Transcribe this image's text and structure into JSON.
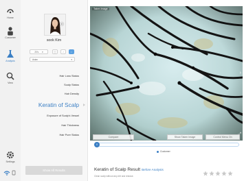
{
  "nav": {
    "items": [
      {
        "label": "Home",
        "icon": "home-icon"
      },
      {
        "label": "Customer",
        "icon": "customer-icon"
      },
      {
        "label": "Analysis",
        "icon": "analysis-icon"
      },
      {
        "label": "View",
        "icon": "view-icon"
      },
      {
        "label": "Settings",
        "icon": "gear-icon"
      }
    ],
    "active": "Analysis"
  },
  "profile": {
    "name": "sook Kim",
    "age_select": "20's",
    "gender_select": "Asian"
  },
  "status_items": [
    {
      "label": "Hair Loss Status"
    },
    {
      "label": "Scalp Status"
    },
    {
      "label": "Hair Density"
    },
    {
      "label": "Keratin of Scalp",
      "active": true
    },
    {
      "label": "Exposure of Scalp's Vessel"
    },
    {
      "label": "Hair Thickness"
    },
    {
      "label": "Hair Pore Status"
    }
  ],
  "show_all_label": "Show All Results",
  "image": {
    "tag_label": "Taken Image",
    "compare_label": "Compare",
    "show_taken_label": "Show Taken Image",
    "control_menu_label": "Control Menu On"
  },
  "slider": {
    "thumb_label": "0",
    "legend_label": "Customer"
  },
  "result": {
    "title": "Keratin of Scalp Result",
    "link": "Before Analysis",
    "description": "Clean scalp without any dirt and residue.",
    "rating": 0,
    "max_rating": 5
  },
  "colors": {
    "accent": "#3b7fc4",
    "star_empty": "#c8c8c8"
  }
}
